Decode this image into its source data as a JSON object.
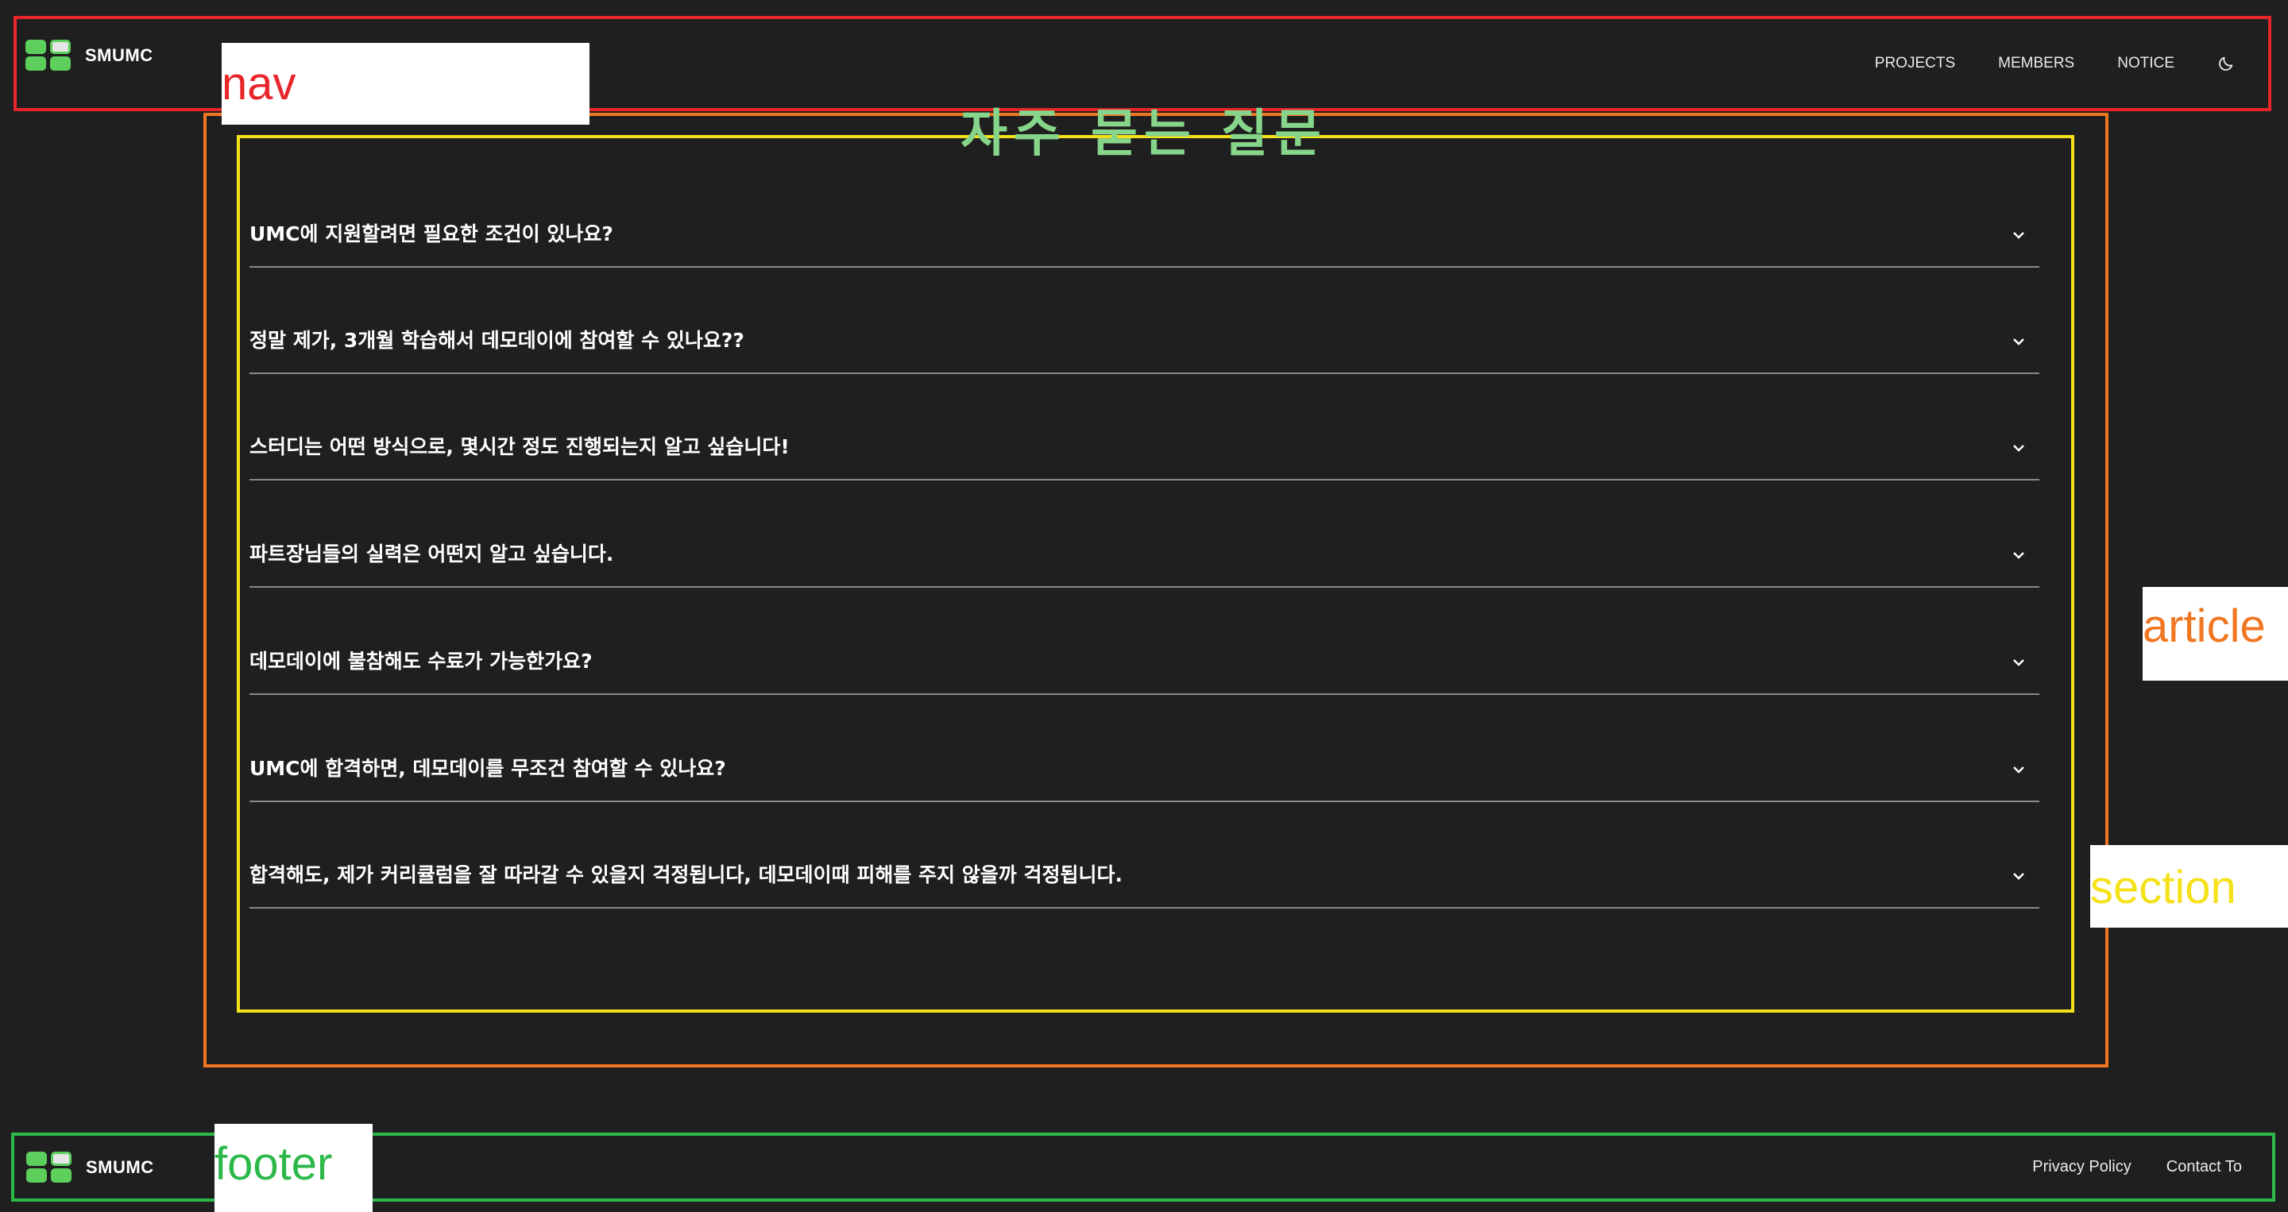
{
  "nav": {
    "brand": "SMUMC",
    "links": [
      "PROJECTS",
      "MEMBERS",
      "NOTICE"
    ],
    "theme_icon": "moon-icon"
  },
  "faq": {
    "title": "자주 묻는 질문",
    "items": [
      "UMC에 지원할려면 필요한 조건이 있나요?",
      "정말 제가, 3개월 학습해서 데모데이에 참여할 수 있나요??",
      "스터디는 어떤 방식으로, 몇시간 정도 진행되는지 알고 싶습니다!",
      "파트장님들의 실력은 어떤지 알고 싶습니다.",
      "데모데이에 불참해도 수료가 가능한가요?",
      "UMC에 합격하면, 데모데이를 무조건 참여할 수 있나요?",
      "합격해도, 제가 커리큘럼을 잘 따라갈 수 있을지 걱정됩니다, 데모데이때 피해를 주지 않을까 걱정됩니다."
    ],
    "chevron_icon": "chevron-down-icon"
  },
  "footer": {
    "brand": "SMUMC",
    "links": [
      "Privacy Policy",
      "Contact To"
    ]
  },
  "tags": {
    "nav": "nav",
    "article": "article",
    "section": "section",
    "footer": "footer"
  },
  "colors": {
    "background": "#1f1f1f",
    "nav_outline": "#e8262a",
    "article_outline": "#f07722",
    "section_outline": "#f5e11a",
    "footer_outline": "#2db84a",
    "title": "#86d58a",
    "logo_green": "#5ccf5c"
  }
}
